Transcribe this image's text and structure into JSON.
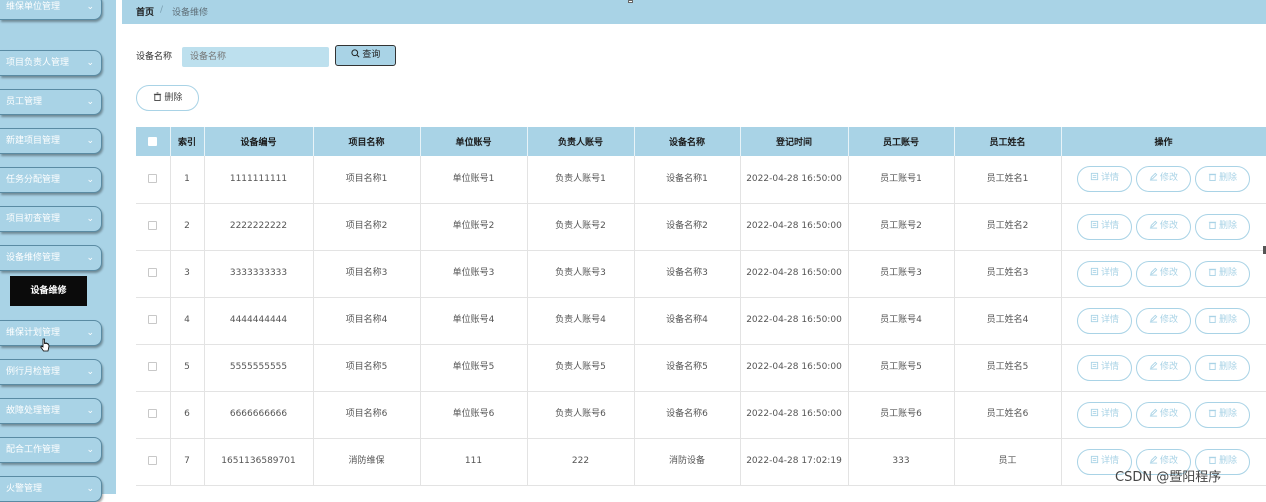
{
  "sidebar": {
    "items": [
      {
        "label": "维保单位管理"
      },
      {
        "label": "项目负责人管理"
      },
      {
        "label": "员工管理"
      },
      {
        "label": "新建项目管理"
      },
      {
        "label": "任务分配管理"
      },
      {
        "label": "项目初查管理"
      },
      {
        "label": "设备维修管理"
      },
      {
        "label": "维保计划管理"
      },
      {
        "label": "例行月检管理"
      },
      {
        "label": "故障处理管理"
      },
      {
        "label": "配合工作管理"
      },
      {
        "label": "火警管理"
      }
    ],
    "submenu_active": "设备维修"
  },
  "breadcrumb": {
    "home": "首页",
    "separator": "/",
    "current": "设备维修"
  },
  "search": {
    "label": "设备名称",
    "placeholder": "设备名称",
    "button": "查询"
  },
  "toolbar": {
    "delete_label": "删除"
  },
  "table": {
    "headers": [
      "索引",
      "设备编号",
      "项目名称",
      "单位账号",
      "负责人账号",
      "设备名称",
      "登记时间",
      "员工账号",
      "员工姓名",
      "操作"
    ],
    "rows": [
      {
        "index": "1",
        "device_no": "1111111111",
        "project": "项目名称1",
        "unit": "单位账号1",
        "owner": "负责人账号1",
        "device": "设备名称1",
        "time": "2022-04-28 16:50:00",
        "staff_no": "员工账号1",
        "staff_name": "员工姓名1"
      },
      {
        "index": "2",
        "device_no": "2222222222",
        "project": "项目名称2",
        "unit": "单位账号2",
        "owner": "负责人账号2",
        "device": "设备名称2",
        "time": "2022-04-28 16:50:00",
        "staff_no": "员工账号2",
        "staff_name": "员工姓名2"
      },
      {
        "index": "3",
        "device_no": "3333333333",
        "project": "项目名称3",
        "unit": "单位账号3",
        "owner": "负责人账号3",
        "device": "设备名称3",
        "time": "2022-04-28 16:50:00",
        "staff_no": "员工账号3",
        "staff_name": "员工姓名3"
      },
      {
        "index": "4",
        "device_no": "4444444444",
        "project": "项目名称4",
        "unit": "单位账号4",
        "owner": "负责人账号4",
        "device": "设备名称4",
        "time": "2022-04-28 16:50:00",
        "staff_no": "员工账号4",
        "staff_name": "员工姓名4"
      },
      {
        "index": "5",
        "device_no": "5555555555",
        "project": "项目名称5",
        "unit": "单位账号5",
        "owner": "负责人账号5",
        "device": "设备名称5",
        "time": "2022-04-28 16:50:00",
        "staff_no": "员工账号5",
        "staff_name": "员工姓名5"
      },
      {
        "index": "6",
        "device_no": "6666666666",
        "project": "项目名称6",
        "unit": "单位账号6",
        "owner": "负责人账号6",
        "device": "设备名称6",
        "time": "2022-04-28 16:50:00",
        "staff_no": "员工账号6",
        "staff_name": "员工姓名6"
      },
      {
        "index": "7",
        "device_no": "1651136589701",
        "project": "消防维保",
        "unit": "111",
        "owner": "222",
        "device": "消防设备",
        "time": "2022-04-28 17:02:19",
        "staff_no": "333",
        "staff_name": "员工"
      }
    ],
    "actions": {
      "detail": "详情",
      "edit": "修改",
      "delete": "删除"
    }
  },
  "watermark": "CSDN @暨阳程序",
  "colors": {
    "accent": "#a9d3e6",
    "sidebar_border": "#5a8ba3",
    "active_submenu": "#0b0b0b"
  },
  "icons": {
    "search": "search-icon",
    "delete": "trash-icon",
    "detail": "detail-icon",
    "edit": "edit-icon",
    "chevron": "chevron-down-icon"
  }
}
